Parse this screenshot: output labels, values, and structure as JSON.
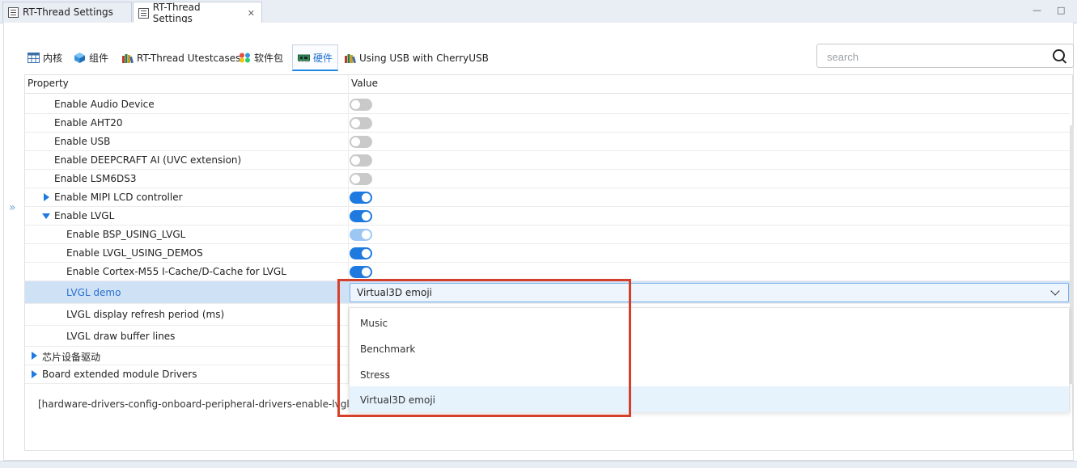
{
  "editor_tabs": [
    {
      "label": "RT-Thread Settings",
      "active": false
    },
    {
      "label": "RT-Thread Settings",
      "active": true
    }
  ],
  "window_controls": {
    "minimize": "—",
    "maximize": "□"
  },
  "sub_tabs": [
    {
      "label": "内核",
      "icon": "table-grid-icon"
    },
    {
      "label": "组件",
      "icon": "cube-icon"
    },
    {
      "label": "RT-Thread Utestcases",
      "icon": "books-icon"
    },
    {
      "label": "软件包",
      "icon": "colorful-package-icon"
    },
    {
      "label": "硬件",
      "icon": "circuit-board-icon",
      "active": true
    },
    {
      "label": "Using USB with CherryUSB",
      "icon": "books-icon"
    }
  ],
  "search": {
    "placeholder": "search",
    "value": ""
  },
  "table": {
    "headers": {
      "property": "Property",
      "value": "Value"
    },
    "rows": [
      {
        "label": "Enable Audio Device",
        "toggle": "off"
      },
      {
        "label": "Enable AHT20",
        "toggle": "off"
      },
      {
        "label": "Enable USB",
        "toggle": "off"
      },
      {
        "label": "Enable DEEPCRAFT AI (UVC extension)",
        "toggle": "off"
      },
      {
        "label": "Enable LSM6DS3",
        "toggle": "off"
      },
      {
        "label": "Enable MIPI LCD controller",
        "toggle": "on",
        "expander": "collapsed"
      },
      {
        "label": "Enable LVGL",
        "toggle": "on",
        "expander": "expanded"
      },
      {
        "label": "Enable BSP_USING_LVGL",
        "toggle": "on-disabled"
      },
      {
        "label": "Enable LVGL_USING_DEMOS",
        "toggle": "on"
      },
      {
        "label": "Enable Cortex-M55 I-Cache/D-Cache for LVGL",
        "toggle": "on"
      },
      {
        "label": "LVGL demo",
        "selected": true
      },
      {
        "label": "LVGL display refresh period (ms)"
      },
      {
        "label": "LVGL draw buffer lines"
      },
      {
        "label": "芯片设备驱动",
        "expander": "collapsed"
      },
      {
        "label": "Board extended module Drivers",
        "expander": "collapsed"
      }
    ]
  },
  "dropdown": {
    "value": "Virtual3D emoji",
    "options": [
      "Music",
      "Benchmark",
      "Stress",
      "Virtual3D emoji"
    ],
    "highlighted": "Virtual3D emoji"
  },
  "description": "[hardware-drivers-config-onboard-peripheral-drivers-enable-lvgl-lv",
  "colors": {
    "accent": "#1f7ae0",
    "highlight_box": "#d6402b",
    "selected_row": "#cfe1f5"
  }
}
